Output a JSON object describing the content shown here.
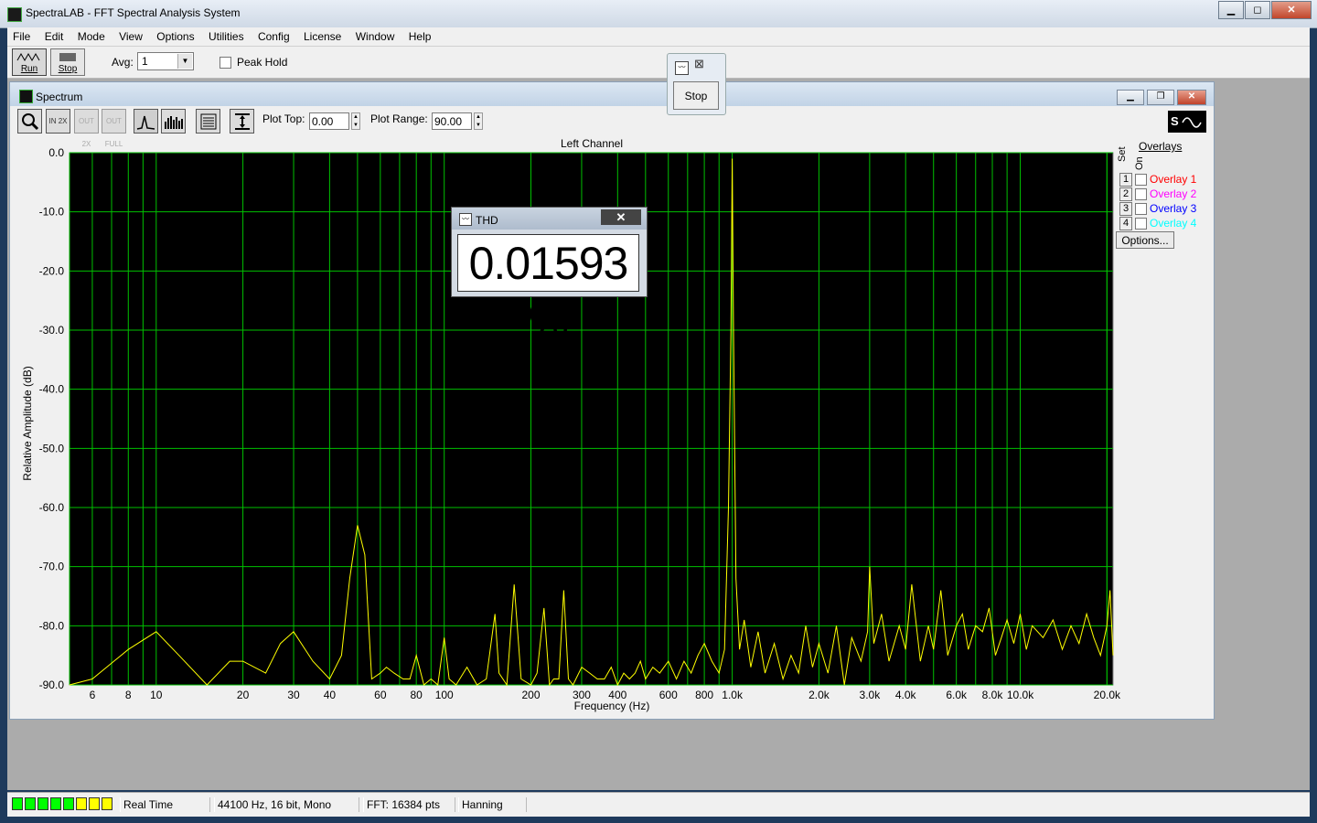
{
  "window": {
    "title": "SpectraLAB - FFT Spectral Analysis System"
  },
  "menu": [
    "File",
    "Edit",
    "Mode",
    "View",
    "Options",
    "Utilities",
    "Config",
    "License",
    "Window",
    "Help"
  ],
  "toolbar": {
    "run_label": "Run",
    "stop_label": "Stop",
    "avg_label": "Avg:",
    "avg_value": "1",
    "peak_hold_label": "Peak Hold"
  },
  "stop_popup": {
    "close_glyph": "⊠",
    "stop_label": "Stop"
  },
  "spectrum": {
    "title": "Spectrum",
    "tool_labels": {
      "zoom_in": "IN 2X",
      "zoom_out": "OUT 2X",
      "full": "OUT FULL"
    },
    "plot_top_label": "Plot Top:",
    "plot_top_value": "0.00",
    "plot_range_label": "Plot Range:",
    "plot_range_value": "90.00",
    "channel_label": "Left Channel",
    "overlays": {
      "title": "Overlays",
      "set_header": "Set",
      "on_header": "On",
      "items": [
        {
          "num": "1",
          "label": "Overlay 1",
          "color": "#ff0000"
        },
        {
          "num": "2",
          "label": "Overlay 2",
          "color": "#ff00ff"
        },
        {
          "num": "3",
          "label": "Overlay 3",
          "color": "#0000ff"
        },
        {
          "num": "4",
          "label": "Overlay 4",
          "color": "#00ffff"
        }
      ],
      "options_label": "Options..."
    }
  },
  "thd": {
    "title": "THD",
    "value": "0.01593 %"
  },
  "status": {
    "meter_colors": [
      "#00ff00",
      "#00ff00",
      "#00ff00",
      "#00ff00",
      "#00ff00",
      "#ffff00",
      "#ffff00",
      "#ffff00"
    ],
    "mode": "Real Time",
    "format": "44100 Hz, 16 bit, Mono",
    "fft": "FFT: 16384 pts",
    "window": "Hanning"
  },
  "chart_data": {
    "type": "line",
    "title": "Left Channel",
    "xlabel": "Frequency (Hz)",
    "ylabel": "Relative Amplitude (dB)",
    "x_scale": "log",
    "xlim": [
      5,
      21000
    ],
    "ylim": [
      -90,
      0
    ],
    "grid": true,
    "line_color": "#ffff00",
    "grid_color": "#00c000",
    "background": "#000000",
    "y_ticks": [
      "0.0",
      "-10.0",
      "-20.0",
      "-30.0",
      "-40.0",
      "-50.0",
      "-60.0",
      "-70.0",
      "-80.0",
      "-90.0"
    ],
    "x_ticks": [
      {
        "v": 6,
        "label": "6"
      },
      {
        "v": 8,
        "label": "8"
      },
      {
        "v": 10,
        "label": "10"
      },
      {
        "v": 20,
        "label": "20"
      },
      {
        "v": 30,
        "label": "30"
      },
      {
        "v": 40,
        "label": "40"
      },
      {
        "v": 60,
        "label": "60"
      },
      {
        "v": 80,
        "label": "80"
      },
      {
        "v": 100,
        "label": "100"
      },
      {
        "v": 200,
        "label": "200"
      },
      {
        "v": 300,
        "label": "300"
      },
      {
        "v": 400,
        "label": "400"
      },
      {
        "v": 600,
        "label": "600"
      },
      {
        "v": 800,
        "label": "800"
      },
      {
        "v": 1000,
        "label": "1.0k"
      },
      {
        "v": 2000,
        "label": "2.0k"
      },
      {
        "v": 3000,
        "label": "3.0k"
      },
      {
        "v": 4000,
        "label": "4.0k"
      },
      {
        "v": 6000,
        "label": "6.0k"
      },
      {
        "v": 8000,
        "label": "8.0k"
      },
      {
        "v": 10000,
        "label": "10.0k"
      },
      {
        "v": 20000,
        "label": "20.0k"
      }
    ],
    "series": [
      {
        "x": [
          5,
          6,
          8,
          10,
          12,
          15,
          18,
          20,
          24,
          27,
          30,
          35,
          40,
          44,
          47,
          50,
          53,
          56,
          60,
          63,
          67,
          72,
          76,
          80,
          85,
          90,
          95,
          100,
          104,
          110,
          120,
          130,
          140,
          150,
          155,
          165,
          175,
          185,
          200,
          210,
          222,
          232,
          240,
          250,
          260,
          270,
          280,
          300,
          320,
          340,
          360,
          380,
          400,
          420,
          440,
          460,
          480,
          500,
          530,
          560,
          600,
          640,
          680,
          720,
          760,
          800,
          850,
          900,
          940,
          970,
          990,
          1000,
          1010,
          1030,
          1060,
          1100,
          1160,
          1230,
          1300,
          1400,
          1500,
          1600,
          1700,
          1800,
          1900,
          2000,
          2150,
          2300,
          2450,
          2600,
          2800,
          2950,
          3000,
          3100,
          3300,
          3500,
          3800,
          4000,
          4200,
          4500,
          4800,
          5000,
          5300,
          5600,
          6000,
          6300,
          6600,
          7000,
          7400,
          7800,
          8200,
          8600,
          9000,
          9500,
          10000,
          10500,
          11000,
          12000,
          13000,
          14000,
          15000,
          16000,
          17000,
          18000,
          19000,
          20000,
          20500,
          21000
        ],
        "y": [
          -90,
          -89,
          -84,
          -81,
          -85,
          -90,
          -86,
          -86,
          -88,
          -83,
          -81,
          -86,
          -89,
          -85,
          -72,
          -63,
          -68,
          -89,
          -88,
          -87,
          -88,
          -89,
          -89,
          -85,
          -90,
          -89,
          -90,
          -82,
          -89,
          -90,
          -87,
          -90,
          -89,
          -78,
          -88,
          -90,
          -73,
          -89,
          -90,
          -88,
          -77,
          -90,
          -89,
          -89,
          -74,
          -89,
          -90,
          -87,
          -88,
          -89,
          -89,
          -87,
          -90,
          -88,
          -89,
          -88,
          -86,
          -89,
          -87,
          -88,
          -86,
          -89,
          -86,
          -88,
          -85,
          -83,
          -86,
          -88,
          -84,
          -60,
          -30,
          -1,
          -30,
          -72,
          -84,
          -79,
          -87,
          -81,
          -88,
          -83,
          -89,
          -85,
          -88,
          -80,
          -87,
          -83,
          -88,
          -80,
          -90,
          -82,
          -86,
          -81,
          -70,
          -83,
          -78,
          -86,
          -80,
          -84,
          -73,
          -86,
          -80,
          -84,
          -74,
          -85,
          -80,
          -78,
          -84,
          -80,
          -81,
          -77,
          -85,
          -82,
          -79,
          -83,
          -78,
          -84,
          -80,
          -82,
          -79,
          -84,
          -80,
          -83,
          -78,
          -82,
          -85,
          -80,
          -74,
          -85
        ]
      }
    ]
  }
}
